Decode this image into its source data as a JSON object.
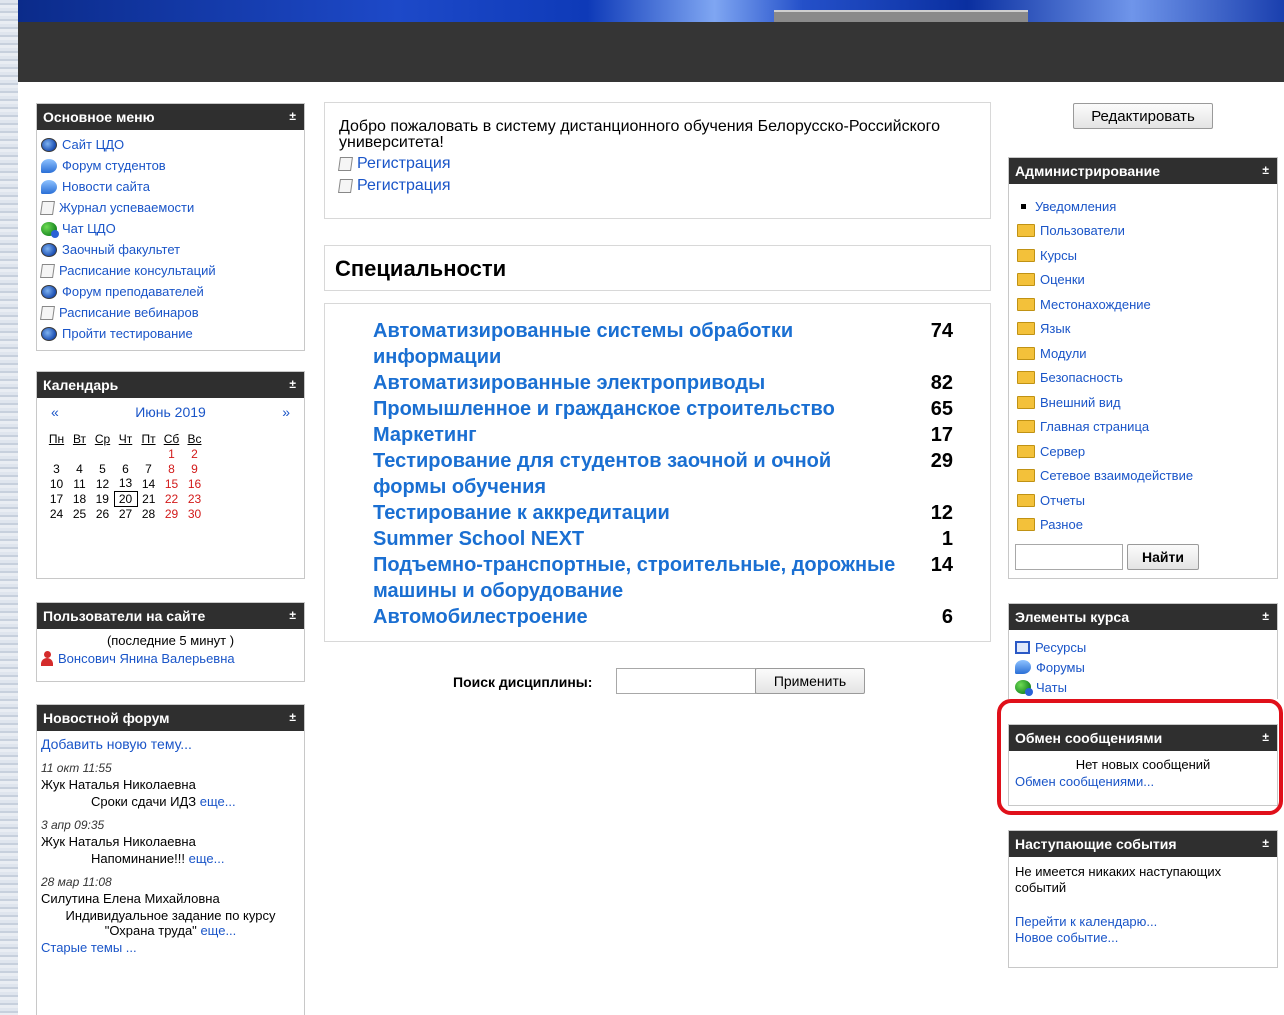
{
  "main_menu": {
    "title": "Основное меню",
    "items": [
      {
        "label": "Сайт ЦДО",
        "icon": "globe-icon"
      },
      {
        "label": "Форум студентов",
        "icon": "forum-icon"
      },
      {
        "label": "Новости сайта",
        "icon": "forum-icon"
      },
      {
        "label": "Журнал успеваемости",
        "icon": "document-icon"
      },
      {
        "label": "Чат ЦДО",
        "icon": "chat-icon"
      },
      {
        "label": "Заочный факультет",
        "icon": "globe-icon"
      },
      {
        "label": "Расписание консультаций",
        "icon": "document-icon"
      },
      {
        "label": "Форум преподавателей",
        "icon": "globe-icon"
      },
      {
        "label": "Расписание вебинаров",
        "icon": "document-icon"
      },
      {
        "label": "Пройти тестирование",
        "icon": "globe-icon"
      }
    ]
  },
  "calendar": {
    "title": "Календарь",
    "prev": "«",
    "next": "»",
    "month": "Июнь 2019",
    "weekdays": [
      "Пн",
      "Вт",
      "Ср",
      "Чт",
      "Пт",
      "Сб",
      "Вс"
    ],
    "weeks": [
      [
        "",
        "",
        "",
        "",
        "",
        "1",
        "2"
      ],
      [
        "3",
        "4",
        "5",
        "6",
        "7",
        "8",
        "9"
      ],
      [
        "10",
        "11",
        "12",
        "13",
        "14",
        "15",
        "16"
      ],
      [
        "17",
        "18",
        "19",
        "20",
        "21",
        "22",
        "23"
      ],
      [
        "24",
        "25",
        "26",
        "27",
        "28",
        "29",
        "30"
      ]
    ],
    "today": "20"
  },
  "online_users": {
    "title": "Пользователи на сайте",
    "subtitle": "(последние 5 минут )",
    "users": [
      "Вонсович Янина Валерьевна"
    ]
  },
  "news_forum": {
    "title": "Новостной форум",
    "add_topic": "Добавить новую тему...",
    "posts": [
      {
        "date": "11 окт 11:55",
        "author": "Жук Наталья Николаевна",
        "subject": "Сроки сдачи ИДЗ",
        "more": "еще..."
      },
      {
        "date": "3 апр 09:35",
        "author": "Жук Наталья Николаевна",
        "subject": "Напоминание!!!",
        "more": "еще..."
      },
      {
        "date": "28 мар 11:08",
        "author": "Силутина Елена Михайловна",
        "subject_line1": "Индивидуальное задание по курсу",
        "subject_line2": "\"Охрана труда\"",
        "more": "еще..."
      }
    ],
    "old_topics": "Старые темы ..."
  },
  "welcome": {
    "text": "Добро пожаловать в систему дистанционного обучения Белорусско-Российского университета!",
    "links": [
      "Регистрация",
      "Регистрация"
    ]
  },
  "specialties": {
    "title": "Специальности",
    "courses": [
      {
        "name": "Автоматизированные системы обработки информации",
        "count": "74"
      },
      {
        "name": "Автоматизированные электроприводы",
        "count": "82"
      },
      {
        "name": "Промышленное и гражданское строительство",
        "count": "65"
      },
      {
        "name": "Маркетинг",
        "count": "17"
      },
      {
        "name": "Тестирование для студентов заочной и очной формы обучения",
        "count": "29"
      },
      {
        "name": "Тестирование к аккредитации",
        "count": "12"
      },
      {
        "name": "Summer School NEXT",
        "count": "1"
      },
      {
        "name": "Подъемно-транспортные, строительные, дорожные машины и оборудование",
        "count": "14"
      },
      {
        "name": "Автомобилестроение",
        "count": "6"
      }
    ]
  },
  "discipline_search": {
    "label": "Поиск дисциплины:",
    "value": "",
    "button": "Применить"
  },
  "edit_button": "Редактировать",
  "administration": {
    "title": "Администрирование",
    "items": [
      "Уведомления",
      "Пользователи",
      "Курсы",
      "Оценки",
      "Местонахождение",
      "Язык",
      "Модули",
      "Безопасность",
      "Внешний вид",
      "Главная страница",
      "Сервер",
      "Сетевое взаимодействие",
      "Отчеты",
      "Разное"
    ],
    "search_button": "Найти"
  },
  "course_elements": {
    "title": "Элементы курса",
    "items": [
      {
        "label": "Ресурсы",
        "icon": "resource-icon"
      },
      {
        "label": "Форумы",
        "icon": "forum-icon"
      },
      {
        "label": "Чаты",
        "icon": "chat-icon"
      }
    ]
  },
  "messaging": {
    "title": "Обмен сообщениями",
    "status": "Нет новых сообщений",
    "link": "Обмен сообщениями..."
  },
  "upcoming": {
    "title": "Наступающие события",
    "text": "Не имеется никаких наступающих событий",
    "links": [
      "Перейти к календарю...",
      "Новое событие..."
    ]
  },
  "toggle_symbol": "±",
  "colors": {
    "link": "#1a55c8",
    "course_link": "#1a6fd2",
    "weekend": "#d21a1a",
    "block_header": "#2f2f2f",
    "highlight": "#e0101a"
  }
}
